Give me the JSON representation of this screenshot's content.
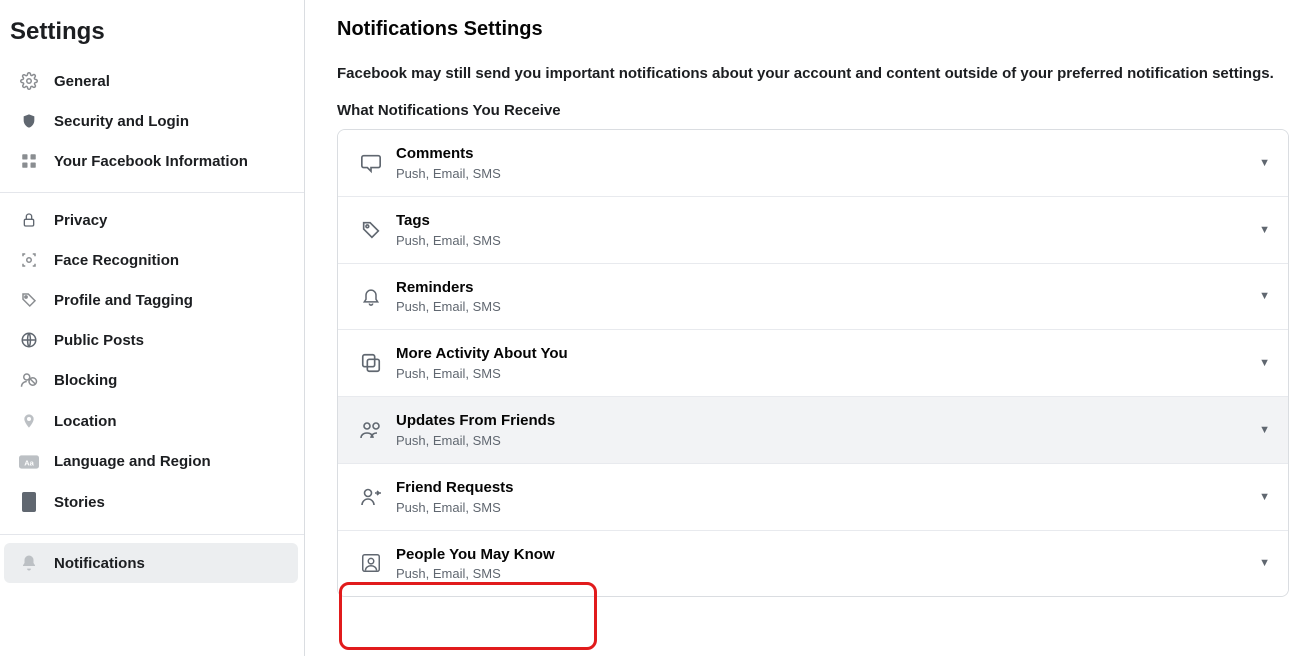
{
  "sidebar": {
    "title": "Settings",
    "groups": [
      {
        "items": [
          "General",
          "Security and Login",
          "Your Facebook Information"
        ]
      },
      {
        "items": [
          "Privacy",
          "Face Recognition",
          "Profile and Tagging",
          "Public Posts",
          "Blocking",
          "Location",
          "Language and Region",
          "Stories"
        ]
      },
      {
        "items": [
          "Notifications"
        ]
      }
    ]
  },
  "main": {
    "title": "Notifications Settings",
    "notice": "Facebook may still send you important notifications about your account and content outside of your preferred notification settings.",
    "section_label": "What Notifications You Receive",
    "sub_default": "Push, Email, SMS",
    "rows": [
      {
        "title": "Comments"
      },
      {
        "title": "Tags"
      },
      {
        "title": "Reminders"
      },
      {
        "title": "More Activity About You"
      },
      {
        "title": "Updates From Friends"
      },
      {
        "title": "Friend Requests"
      },
      {
        "title": "People You May Know"
      }
    ]
  }
}
